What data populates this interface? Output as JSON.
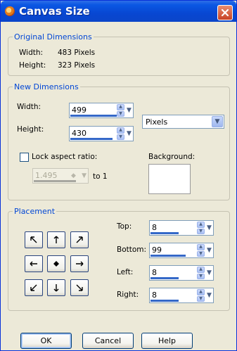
{
  "window": {
    "title": "Canvas Size"
  },
  "original": {
    "group_label": "Original Dimensions",
    "width_label": "Width:",
    "width_value": "483 Pixels",
    "height_label": "Height:",
    "height_value": "323 Pixels"
  },
  "new_dims": {
    "group_label": "New Dimensions",
    "width_label": "Width:",
    "width_value": "499",
    "height_label": "Height:",
    "height_value": "430",
    "units_selected": "Pixels",
    "lock_label": "Lock aspect ratio:",
    "ratio_value": "1.495",
    "to_label": "to 1",
    "background_label": "Background:"
  },
  "placement": {
    "group_label": "Placement",
    "top_label": "Top:",
    "top_value": "8",
    "bottom_label": "Bottom:",
    "bottom_value": "99",
    "left_label": "Left:",
    "left_value": "8",
    "right_label": "Right:",
    "right_value": "8"
  },
  "buttons": {
    "ok": "OK",
    "cancel": "Cancel",
    "help": "Help"
  },
  "icons": {
    "close": "close-icon",
    "app": "paint-palette-icon",
    "anchors": [
      "arrow-up-left-icon",
      "arrow-up-icon",
      "arrow-up-right-icon",
      "arrow-left-icon",
      "center-dot-icon",
      "arrow-right-icon",
      "arrow-down-left-icon",
      "arrow-down-icon",
      "arrow-down-right-icon"
    ]
  },
  "colors": {
    "titlebar": "#0a57e3",
    "group_label": "#0046d5",
    "close_button": "#c84326"
  }
}
